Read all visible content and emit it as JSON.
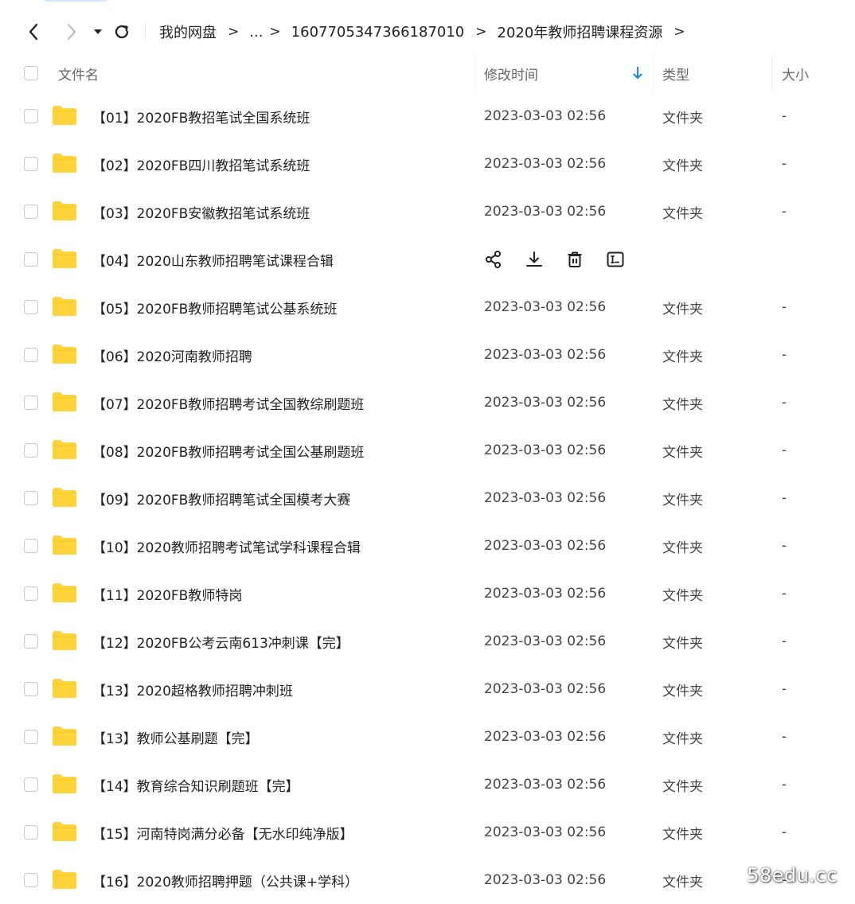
{
  "breadcrumb": {
    "items": [
      "我的网盘",
      "...",
      "1607705347366187010",
      "2020年教师招聘课程资源"
    ],
    "separator": ">"
  },
  "header": {
    "name": "文件名",
    "modified": "修改时间",
    "type": "类型",
    "size": "大小"
  },
  "icons": {
    "back": "chevron-left-icon",
    "forward": "chevron-right-icon",
    "history": "caret-down-icon",
    "refresh": "refresh-icon",
    "sort": "arrow-down-icon",
    "folder": "folder-icon",
    "share": "share-icon",
    "download": "download-icon",
    "delete": "trash-icon",
    "rename": "rename-icon"
  },
  "colors": {
    "folder": "#FFD43B",
    "accent": "#1E88E5"
  },
  "files": [
    {
      "name": "【01】2020FB教招笔试全国系统班",
      "modified": "2023-03-03 02:56",
      "type": "文件夹",
      "size": "-"
    },
    {
      "name": "【02】2020FB四川教招笔试系统班",
      "modified": "2023-03-03 02:56",
      "type": "文件夹",
      "size": "-"
    },
    {
      "name": "【03】2020FB安徽教招笔试系统班",
      "modified": "2023-03-03 02:56",
      "type": "文件夹",
      "size": "-"
    },
    {
      "name": "【04】2020山东教师招聘笔试课程合辑",
      "hover": true
    },
    {
      "name": "【05】2020FB教师招聘笔试公基系统班",
      "modified": "2023-03-03 02:56",
      "type": "文件夹",
      "size": "-"
    },
    {
      "name": "【06】2020河南教师招聘",
      "modified": "2023-03-03 02:56",
      "type": "文件夹",
      "size": "-"
    },
    {
      "name": "【07】2020FB教师招聘考试全国教综刷题班",
      "modified": "2023-03-03 02:56",
      "type": "文件夹",
      "size": "-"
    },
    {
      "name": "【08】2020FB教师招聘考试全国公基刷题班",
      "modified": "2023-03-03 02:56",
      "type": "文件夹",
      "size": "-"
    },
    {
      "name": "【09】2020FB教师招聘笔试全国模考大赛",
      "modified": "2023-03-03 02:56",
      "type": "文件夹",
      "size": "-"
    },
    {
      "name": "【10】2020教师招聘考试笔试学科课程合辑",
      "modified": "2023-03-03 02:56",
      "type": "文件夹",
      "size": "-"
    },
    {
      "name": "【11】2020FB教师特岗",
      "modified": "2023-03-03 02:56",
      "type": "文件夹",
      "size": "-"
    },
    {
      "name": "【12】2020FB公考云南613冲刺课【完】",
      "modified": "2023-03-03 02:56",
      "type": "文件夹",
      "size": "-"
    },
    {
      "name": "【13】2020超格教师招聘冲刺班",
      "modified": "2023-03-03 02:56",
      "type": "文件夹",
      "size": "-"
    },
    {
      "name": "【13】教师公基刷题【完】",
      "modified": "2023-03-03 02:56",
      "type": "文件夹",
      "size": "-"
    },
    {
      "name": "【14】教育综合知识刷题班【完】",
      "modified": "2023-03-03 02:56",
      "type": "文件夹",
      "size": "-"
    },
    {
      "name": "【15】河南特岗满分必备【无水印纯净版】",
      "modified": "2023-03-03 02:56",
      "type": "文件夹",
      "size": "-"
    },
    {
      "name": "【16】2020教师招聘押题（公共课+学科）",
      "modified": "2023-03-03 02:56",
      "type": "文件夹",
      "size": "-"
    }
  ],
  "watermark": "58edu.cc"
}
